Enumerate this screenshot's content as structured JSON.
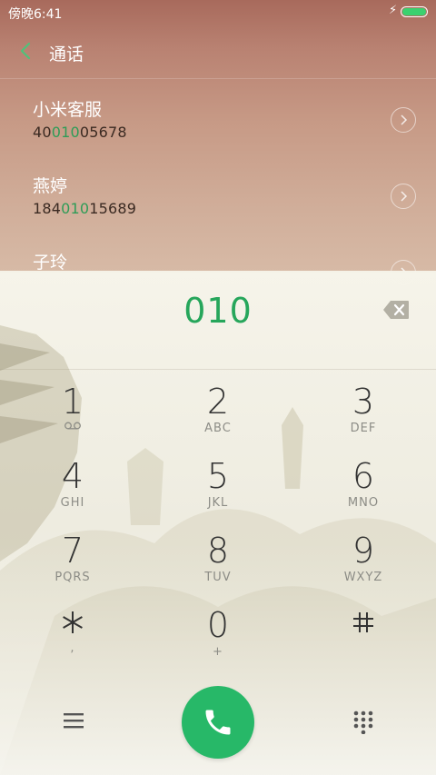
{
  "status_bar": {
    "time": "傍晚6:41",
    "battery_level": 1.0,
    "battery_color": "#3bd16f"
  },
  "header": {
    "title": "通话",
    "back_icon": "chevron-left-icon",
    "accent": "#4fc27a"
  },
  "contacts": [
    {
      "name": "小米客服",
      "number_pre": "40",
      "number_match": "010",
      "number_post": "05678"
    },
    {
      "name": "燕婷",
      "number_pre": "184",
      "number_match": "010",
      "number_post": "15689"
    },
    {
      "name": "子玲",
      "number_pre": "",
      "number_match": "",
      "number_post": ""
    }
  ],
  "dialer": {
    "input_value": "010",
    "input_color": "#26a65b",
    "keys": [
      {
        "digit": "1",
        "letters": "",
        "sub_icon": "voicemail-icon"
      },
      {
        "digit": "2",
        "letters": "ABC"
      },
      {
        "digit": "3",
        "letters": "DEF"
      },
      {
        "digit": "4",
        "letters": "GHI"
      },
      {
        "digit": "5",
        "letters": "JKL"
      },
      {
        "digit": "6",
        "letters": "MNO"
      },
      {
        "digit": "7",
        "letters": "PQRS"
      },
      {
        "digit": "8",
        "letters": "TUV"
      },
      {
        "digit": "9",
        "letters": "WXYZ"
      },
      {
        "digit": "*",
        "letters": ",",
        "sub_icon": "asterisk-icon"
      },
      {
        "digit": "0",
        "letters": "+"
      },
      {
        "digit": "#",
        "letters": "",
        "sub_icon": "hash-icon"
      }
    ]
  },
  "bottom_bar": {
    "menu_icon": "menu-icon",
    "call_icon": "phone-icon",
    "call_color": "#27b868",
    "keypad_icon": "keypad-grid-icon"
  }
}
